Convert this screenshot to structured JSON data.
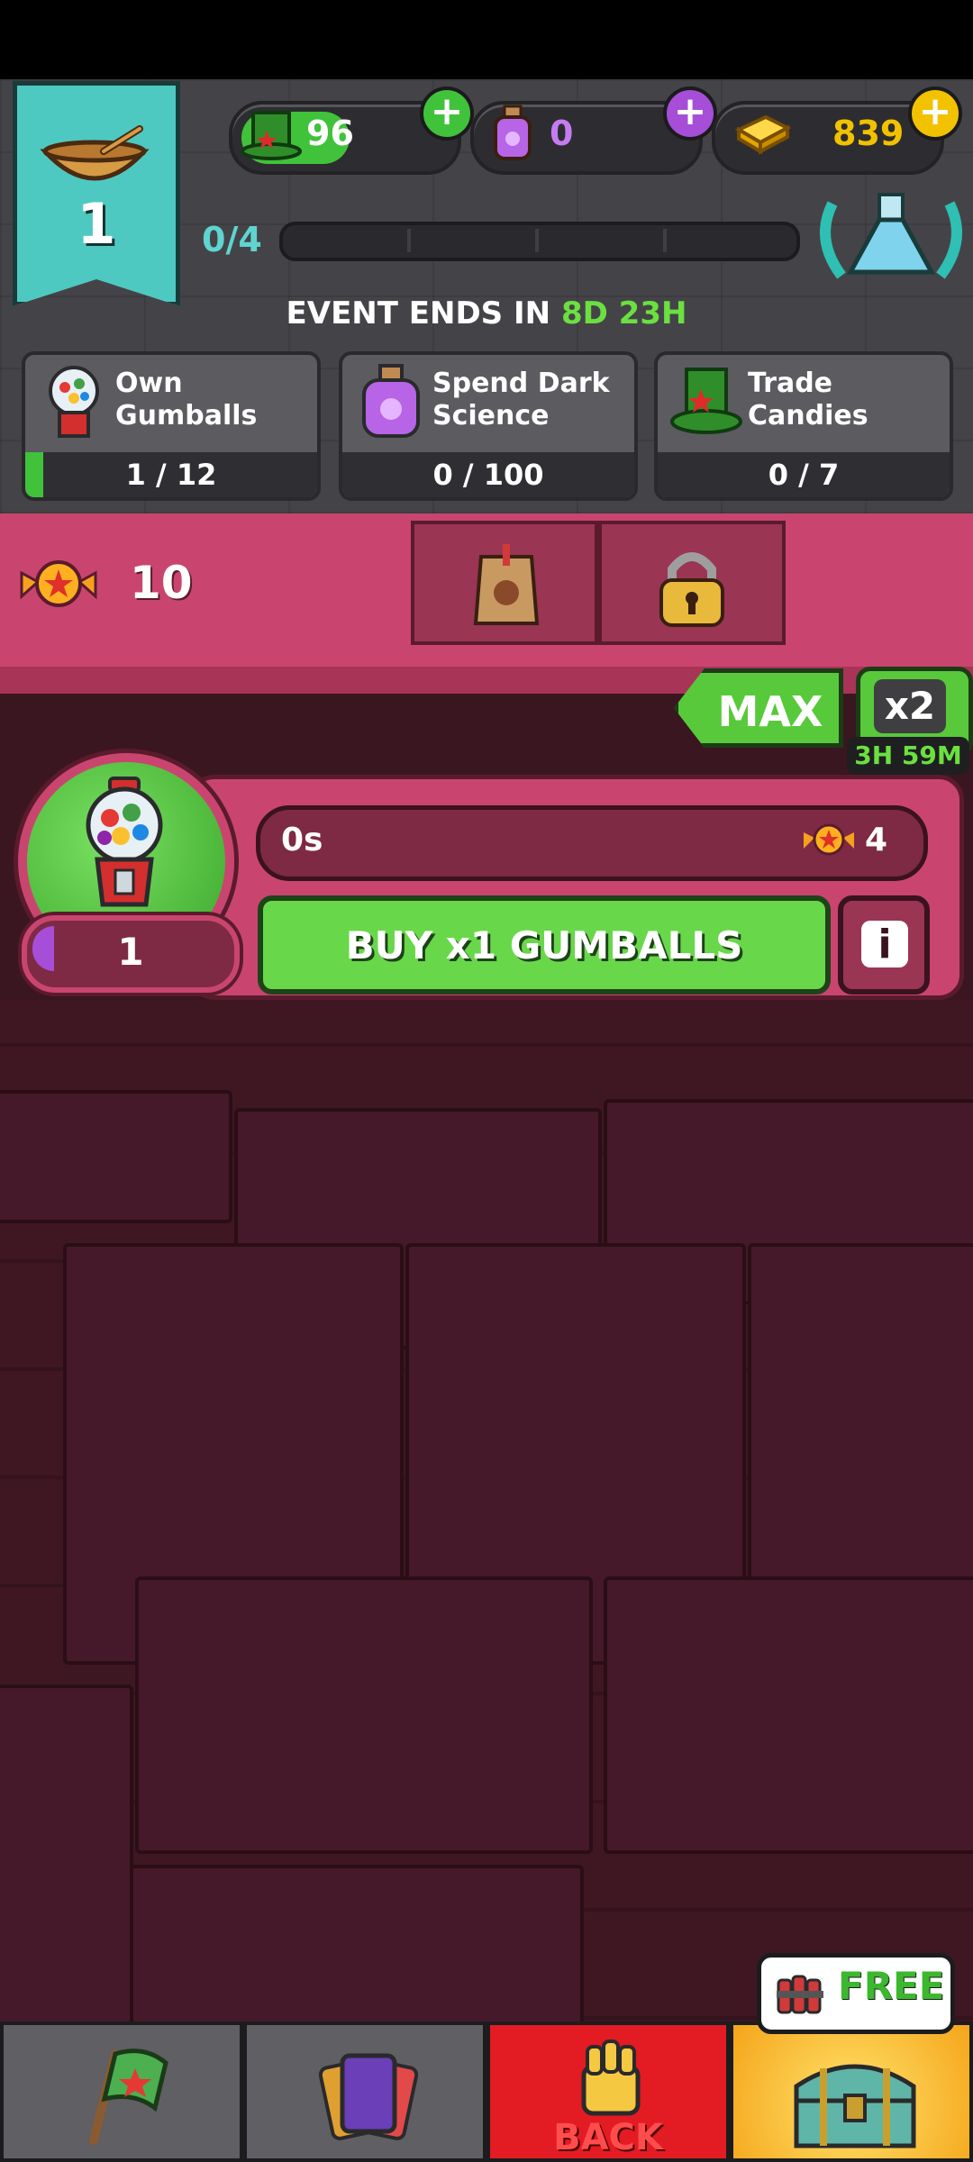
{
  "header": {
    "level": "1",
    "currencies": [
      {
        "name": "green-hats",
        "value": "96",
        "color": "#41c23b"
      },
      {
        "name": "dark-science",
        "value": "0",
        "color": "#a64ed8"
      },
      {
        "name": "gold",
        "value": "839",
        "color": "#f2c200"
      }
    ],
    "level_progress": "0/4",
    "level_progress_fraction": 0.0
  },
  "event": {
    "label": "EVENT ENDS IN",
    "time": "8D 23H"
  },
  "tasks": [
    {
      "label_line1": "Own",
      "label_line2": "Gumballs",
      "count": "1 / 12",
      "progress": 0.083,
      "icon": "gumball-machine-icon"
    },
    {
      "label_line1": "Spend Dark",
      "label_line2": "Science",
      "count": "0 / 100",
      "progress": 0.0,
      "icon": "potion-jar-icon"
    },
    {
      "label_line1": "Trade",
      "label_line2": "Candies",
      "count": "0 / 7",
      "progress": 0.0,
      "icon": "green-hat-icon"
    }
  ],
  "shop": {
    "candy_count": "10",
    "max_label": "MAX",
    "x2_label": "x2",
    "x2_timer": "3H 59M"
  },
  "generator": {
    "timer": "0s",
    "cost": "4",
    "level": "1",
    "level_progress": 0.05,
    "buy_label": "BUY x1 GUMBALLS",
    "info_label": "i"
  },
  "bottom_nav": {
    "back_label": "BACK",
    "free_label": "FREE"
  }
}
